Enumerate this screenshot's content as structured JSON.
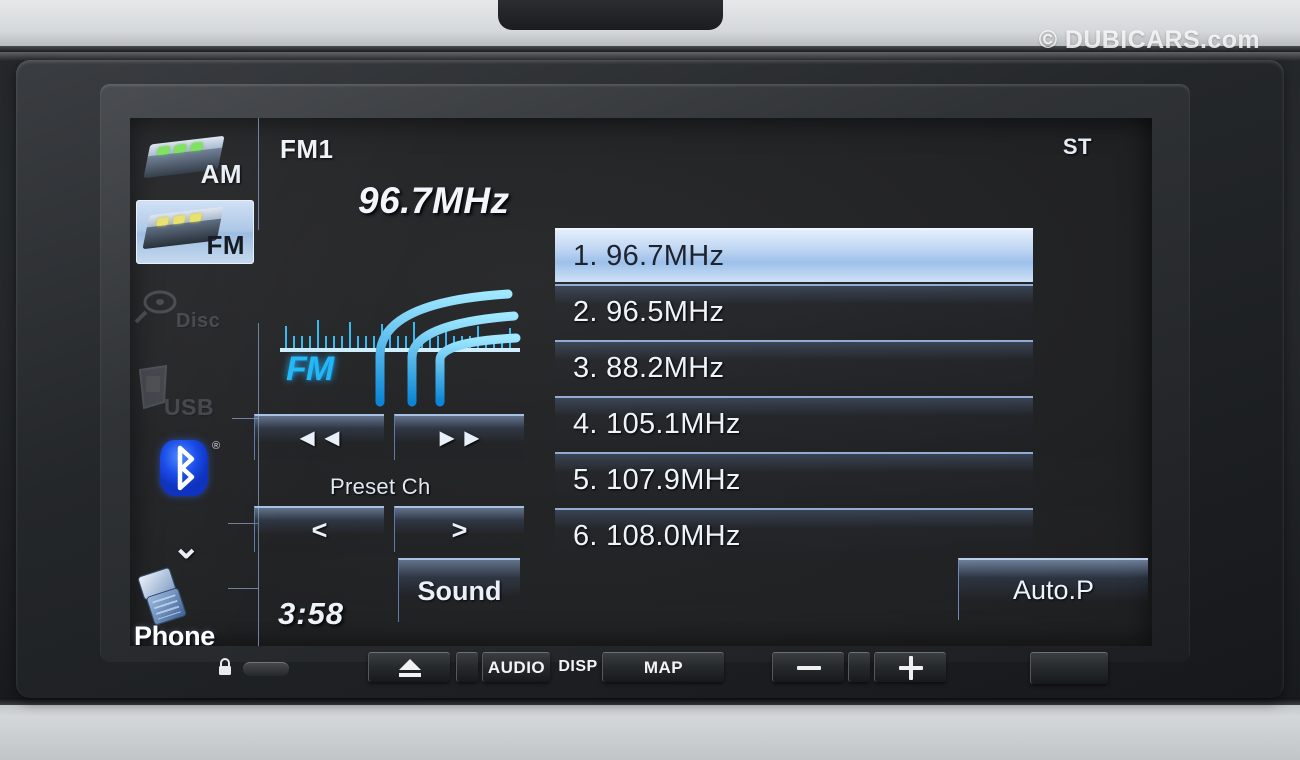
{
  "photo": {
    "watermark": "© DUBICARS.com"
  },
  "screen": {
    "header": {
      "band": "FM1",
      "stereo_indicator": "ST",
      "frequency": "96.7MHz"
    },
    "artwork": {
      "label": "FM"
    },
    "sidebar": {
      "sources": [
        {
          "label": "AM",
          "name": "am",
          "active": false
        },
        {
          "label": "FM",
          "name": "fm",
          "active": true
        },
        {
          "label": "Disc",
          "name": "disc",
          "active": false,
          "dimmed": true
        },
        {
          "label": "USB",
          "name": "usb",
          "active": false,
          "dimmed": true
        },
        {
          "label": "Bluetooth",
          "name": "bluetooth",
          "active": false
        },
        {
          "label": "Phone",
          "name": "phone",
          "active": false
        }
      ],
      "bluetooth_badge": "®",
      "more_chevron": "⌄"
    },
    "controls": {
      "seek_back": "◄◄",
      "seek_forward": "►►",
      "preset_label": "Preset Ch",
      "preset_prev": "<",
      "preset_next": ">",
      "clock": "3:58",
      "sound_button": "Sound",
      "auto_preset_button": "Auto.P"
    },
    "presets": [
      {
        "index": "1.",
        "frequency": "96.7MHz",
        "selected": true
      },
      {
        "index": "2.",
        "frequency": "96.5MHz",
        "selected": false
      },
      {
        "index": "3.",
        "frequency": "88.2MHz",
        "selected": false
      },
      {
        "index": "4.",
        "frequency": "105.1MHz",
        "selected": false
      },
      {
        "index": "5.",
        "frequency": "107.9MHz",
        "selected": false
      },
      {
        "index": "6.",
        "frequency": "108.0MHz",
        "selected": false
      }
    ]
  },
  "hardware": {
    "lock_icon": "🔒",
    "buttons": [
      {
        "label": "",
        "name": "eject-button"
      },
      {
        "label": "",
        "name": "blank-small-button"
      },
      {
        "label": "AUDIO",
        "name": "audio-button"
      },
      {
        "label": "DISP",
        "name": "disp-button"
      },
      {
        "label": "MAP",
        "name": "map-button"
      },
      {
        "label": "",
        "name": "volume-down-button"
      },
      {
        "label": "",
        "name": "blank-mid-button"
      },
      {
        "label": "",
        "name": "volume-up-button"
      },
      {
        "label": "",
        "name": "power-button"
      }
    ]
  },
  "colors": {
    "accent_blue": "#23b7f5",
    "highlight": "#bcd4f2",
    "bluetooth": "#1649e8",
    "screen_bg": "#212224"
  }
}
